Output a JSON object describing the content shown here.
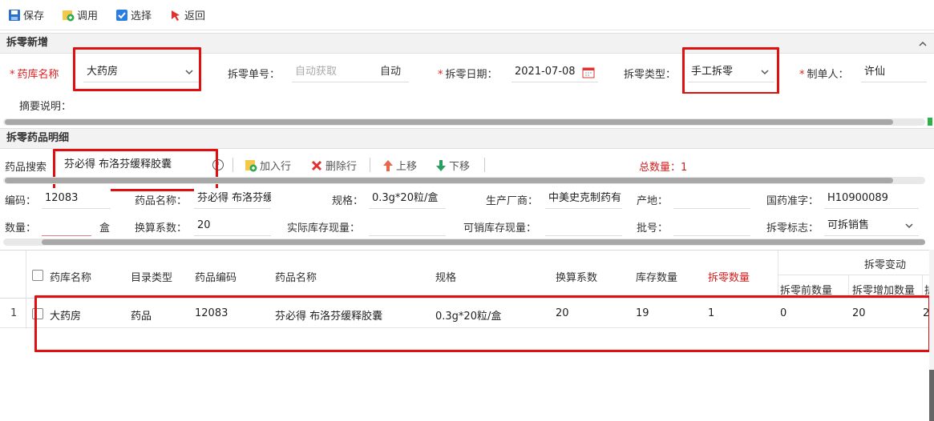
{
  "toolbar": {
    "save": "保存",
    "invoke": "调用",
    "select": "选择",
    "back": "返回"
  },
  "section_new": {
    "title": "拆零新增",
    "collapse_icon": "chevron-up"
  },
  "form": {
    "pharmacy_label": "药库名称",
    "pharmacy_value": "大药房",
    "doc_no_label": "拆零单号：",
    "doc_no_placeholder": "自动获取",
    "doc_no_suffix": "自动",
    "date_label": "拆零日期：",
    "date_value": "2021-07-08",
    "type_label": "拆零类型：",
    "type_value": "手工拆零",
    "maker_label": "制单人：",
    "maker_value": "许仙",
    "remark_label": "摘要说明："
  },
  "section_detail": {
    "title": "拆零药品明细"
  },
  "detail_toolbar": {
    "search_label": "药品搜索",
    "search_value": "芬必得 布洛芬缓释胶囊",
    "add_row": "加入行",
    "delete_row": "删除行",
    "move_up": "上移",
    "move_down": "下移",
    "total": "总数量：1"
  },
  "drug_info": {
    "code_label": "编码：",
    "code_value": "12083",
    "name_label": "药品名称：",
    "name_value": "芬必得 布洛芬缓释胶囊",
    "spec_label": "规格：",
    "spec_value": "0.3g*20粒/盒",
    "maker_label": "生产厂商：",
    "maker_value": "中美史克制药有限公司",
    "origin_label": "产地：",
    "origin_value": "",
    "approval_label": "国药准字：",
    "approval_value": "H10900089",
    "qty_label": "数量：",
    "qty_unit": "盒",
    "factor_label": "换算系数：",
    "factor_value": "20",
    "actual_stock_label": "实际库存现量：",
    "sellable_stock_label": "可销库存现量：",
    "batch_label": "批号：",
    "flag_label": "拆零标志：",
    "flag_value": "可拆销售"
  },
  "grid": {
    "headers": {
      "pharmacy": "药库名称",
      "catalog": "目录类型",
      "code": "药品编码",
      "name": "药品名称",
      "spec": "规格",
      "factor": "换算系数",
      "stock": "库存数量",
      "split_qty": "拆零数量",
      "change_group": "拆零变动",
      "before_qty": "拆零前数量",
      "add_qty": "拆零增加数量",
      "more": "拆"
    },
    "rows": [
      {
        "index": "1",
        "pharmacy": "大药房",
        "catalog": "药品",
        "code": "12083",
        "name": "芬必得 布洛芬缓释胶囊",
        "spec": "0.3g*20粒/盒",
        "factor": "20",
        "stock": "19",
        "split_qty": "1",
        "before_qty": "0",
        "add_qty": "20",
        "more": "2"
      }
    ]
  },
  "colors": {
    "required": "#e02020",
    "highlight_box": "#e01010",
    "accent_blue": "#2a7de1"
  }
}
